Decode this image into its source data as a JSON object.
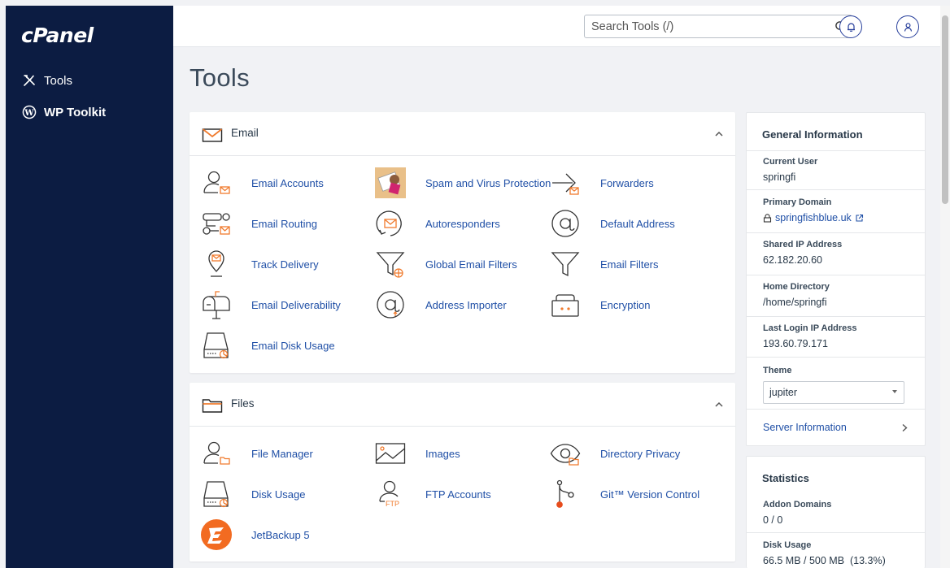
{
  "sidebar": {
    "logo": "cPanel",
    "items": [
      {
        "label": "Tools",
        "icon": "tools-icon"
      },
      {
        "label": "WP Toolkit",
        "icon": "wordpress-icon"
      }
    ]
  },
  "header": {
    "search_placeholder": "Search Tools (/)",
    "notifications_icon": "bell-icon",
    "user_icon": "user-icon"
  },
  "page_title": "Tools",
  "email_panel": {
    "title": "Email",
    "tools": [
      {
        "label": "Email Accounts",
        "icon": "email-accounts-icon"
      },
      {
        "label": "Spam and Virus Protection",
        "icon": "spam-protection-icon"
      },
      {
        "label": "Forwarders",
        "icon": "forwarders-icon"
      },
      {
        "label": "Email Routing",
        "icon": "email-routing-icon"
      },
      {
        "label": "Autoresponders",
        "icon": "autoresponders-icon"
      },
      {
        "label": "Default Address",
        "icon": "default-address-icon"
      },
      {
        "label": "Track Delivery",
        "icon": "track-delivery-icon"
      },
      {
        "label": "Global Email Filters",
        "icon": "global-filters-icon"
      },
      {
        "label": "Email Filters",
        "icon": "email-filters-icon"
      },
      {
        "label": "Email Deliverability",
        "icon": "email-deliverability-icon"
      },
      {
        "label": "Address Importer",
        "icon": "address-importer-icon"
      },
      {
        "label": "Encryption",
        "icon": "encryption-icon"
      },
      {
        "label": "Email Disk Usage",
        "icon": "email-disk-usage-icon"
      }
    ]
  },
  "files_panel": {
    "title": "Files",
    "tools": [
      {
        "label": "File Manager",
        "icon": "file-manager-icon"
      },
      {
        "label": "Images",
        "icon": "images-icon"
      },
      {
        "label": "Directory Privacy",
        "icon": "directory-privacy-icon"
      },
      {
        "label": "Disk Usage",
        "icon": "disk-usage-icon"
      },
      {
        "label": "FTP Accounts",
        "icon": "ftp-accounts-icon"
      },
      {
        "label": "Git™ Version Control",
        "icon": "git-icon"
      },
      {
        "label": "JetBackup 5",
        "icon": "jetbackup-icon"
      }
    ]
  },
  "general_info": {
    "title": "General Information",
    "current_user_label": "Current User",
    "current_user": "springfi",
    "primary_domain_label": "Primary Domain",
    "primary_domain": "springfishblue.uk",
    "shared_ip_label": "Shared IP Address",
    "shared_ip": "62.182.20.60",
    "home_dir_label": "Home Directory",
    "home_dir": "/home/springfi",
    "last_login_label": "Last Login IP Address",
    "last_login": "193.60.79.171",
    "theme_label": "Theme",
    "theme": "jupiter",
    "server_info": "Server Information"
  },
  "statistics": {
    "title": "Statistics",
    "addon_label": "Addon Domains",
    "addon_value": "0 / 0",
    "disk_label": "Disk Usage",
    "disk_value": "66.5 MB / 500 MB  (13.3%)"
  },
  "colors": {
    "sidebar": "#0c1c42",
    "accent_blue": "#1f4fa6",
    "icon_orange": "#f07b2e"
  }
}
